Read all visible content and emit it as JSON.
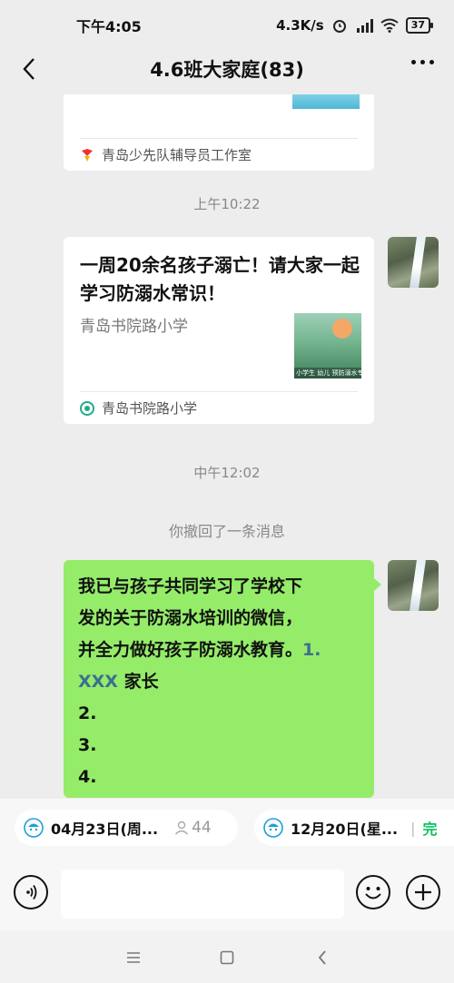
{
  "status_bar": {
    "time": "下午4:05",
    "network_speed": "4.3K/s",
    "battery": "37",
    "icons": [
      "alarm-icon",
      "hd-signal-icon",
      "wifi-icon",
      "battery-icon"
    ]
  },
  "nav": {
    "title": "4.6班大家庭(83)",
    "back_icon": "back-arrow-icon",
    "more_icon": "more-icon"
  },
  "messages": {
    "card_top": {
      "source": "青岛少先队辅导员工作室"
    },
    "time_1": "上午10:22",
    "article": {
      "title": "一周20余名孩子溺亡！请大家一起学习防溺水常识！",
      "account": "青岛书院路小学",
      "thumb_caption": "小学生 幼儿 预防溺水专题",
      "source": "青岛书院路小学"
    },
    "time_2": "中午12:02",
    "recall_notice": "你撤回了一条消息",
    "bubble": {
      "line1": "我已与孩子共同学习了学校下",
      "line2": "发的关于防溺水培训的微信，",
      "line3_text": "并全力做好孩子防溺水教育。",
      "line3_link": "1.",
      "line4_link": "XXX",
      "line4_text": " 家长",
      "line5": "2.",
      "line6": "3.",
      "line7": "4."
    }
  },
  "solitaire_bar": {
    "pill1_date": "04月23日(周...",
    "pill1_count": "44",
    "pill2_date": "12月20日(星...",
    "pill2_status": "完"
  },
  "input_bar": {
    "placeholder": "",
    "icons": [
      "voice-icon",
      "emoji-icon",
      "plus-icon"
    ]
  },
  "colors": {
    "bubble_green": "#95ec69",
    "wechat_green": "#07c160",
    "background": "#ededed"
  }
}
